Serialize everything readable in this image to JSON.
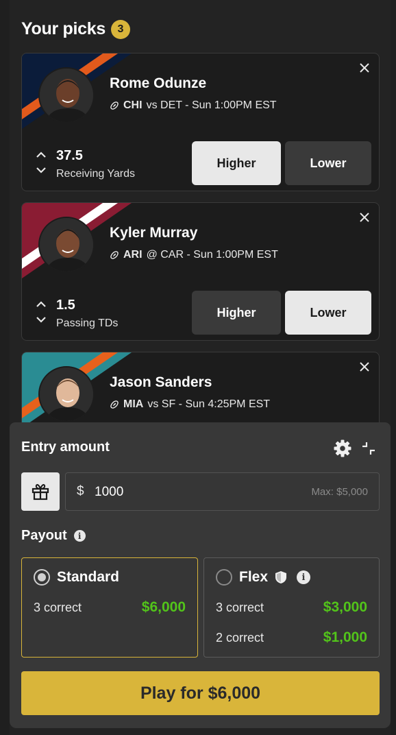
{
  "header": {
    "title": "Your picks",
    "count": "3"
  },
  "picks": [
    {
      "name": "Rome Odunze",
      "team": "CHI",
      "matchup": "vs DET - Sun 1:00PM EST",
      "line": "37.5",
      "stat": "Receiving Yards",
      "higher_label": "Higher",
      "lower_label": "Lower",
      "selected": "higher",
      "colors": {
        "primary": "#0b1c3a",
        "secondary": "#e25a1c"
      },
      "icon": "football-icon"
    },
    {
      "name": "Kyler Murray",
      "team": "ARI",
      "matchup": "@ CAR - Sun 1:00PM EST",
      "line": "1.5",
      "stat": "Passing TDs",
      "higher_label": "Higher",
      "lower_label": "Lower",
      "selected": "lower",
      "colors": {
        "primary": "#8a1c33",
        "secondary": "#ffffff"
      },
      "icon": "football-icon"
    },
    {
      "name": "Jason Sanders",
      "team": "MIA",
      "matchup": "vs SF - Sun 4:25PM EST",
      "colors": {
        "primary": "#2a8c93",
        "secondary": "#e8611c"
      },
      "icon": "football-icon"
    }
  ],
  "entry": {
    "title": "Entry amount",
    "currency_symbol": "$",
    "amount": "1000",
    "max_label": "Max: $5,000"
  },
  "payout": {
    "title": "Payout",
    "standard": {
      "label": "Standard",
      "rows": [
        {
          "label": "3 correct",
          "amount": "$6,000"
        }
      ]
    },
    "flex": {
      "label": "Flex",
      "rows": [
        {
          "label": "3 correct",
          "amount": "$3,000"
        },
        {
          "label": "2 correct",
          "amount": "$1,000"
        }
      ]
    }
  },
  "play_button": "Play for $6,000",
  "colors": {
    "accent": "#d9b53a",
    "positive": "#52c41a",
    "background": "#1f1f1f"
  }
}
